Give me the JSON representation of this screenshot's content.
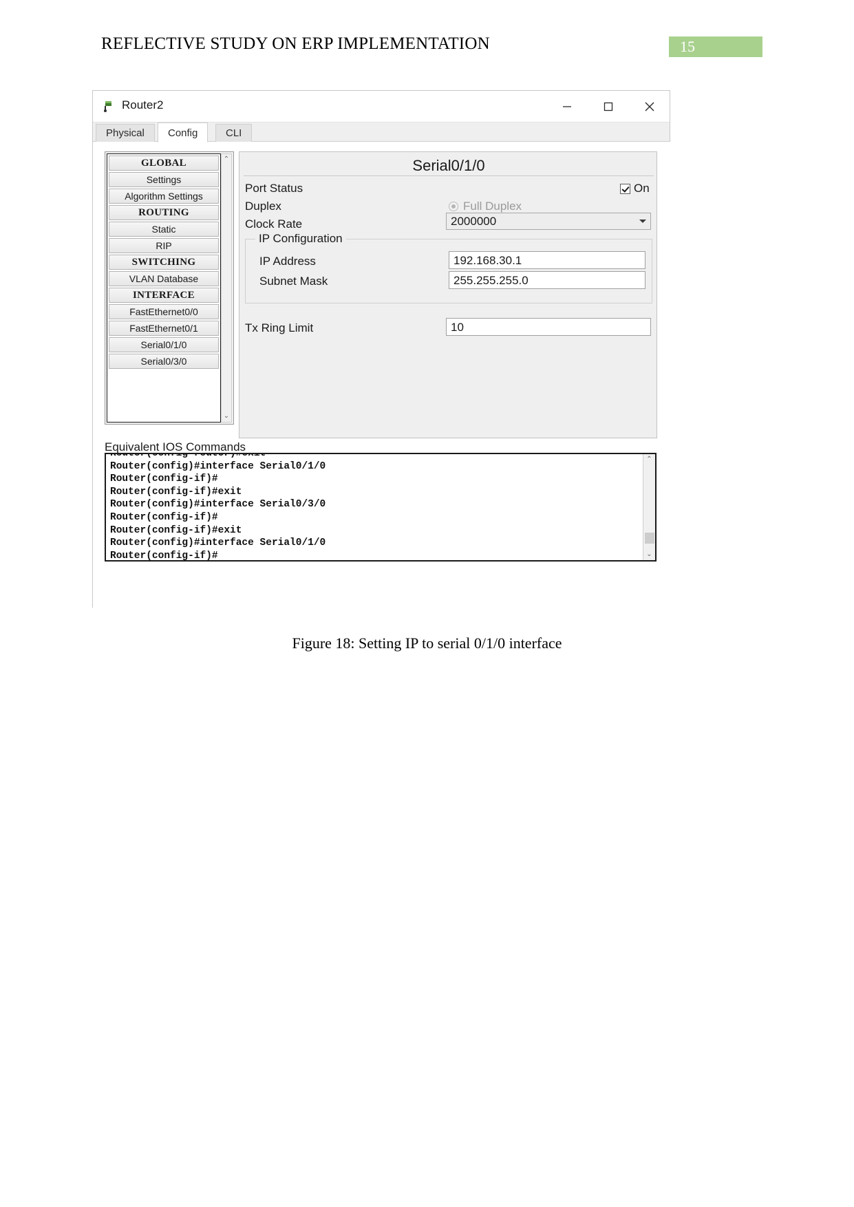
{
  "document": {
    "title": "REFLECTIVE STUDY ON ERP IMPLEMENTATION",
    "page_number": "15",
    "page_badge_color": "#a9d18e",
    "figure_caption": "Figure 18: Setting IP to serial 0/1/0 interface"
  },
  "window": {
    "title": "Router2",
    "icon": "router-icon",
    "controls": {
      "minimize": "—",
      "maximize": "□",
      "close": "✕"
    }
  },
  "tabs": [
    {
      "label": "Physical",
      "active": false
    },
    {
      "label": "Config",
      "active": true
    },
    {
      "label": "CLI",
      "active": false
    }
  ],
  "sidebar": {
    "items": [
      {
        "label": "GLOBAL",
        "type": "header"
      },
      {
        "label": "Settings",
        "type": "item"
      },
      {
        "label": "Algorithm Settings",
        "type": "item"
      },
      {
        "label": "ROUTING",
        "type": "header"
      },
      {
        "label": "Static",
        "type": "item"
      },
      {
        "label": "RIP",
        "type": "item"
      },
      {
        "label": "SWITCHING",
        "type": "header"
      },
      {
        "label": "VLAN Database",
        "type": "item"
      },
      {
        "label": "INTERFACE",
        "type": "header"
      },
      {
        "label": "FastEthernet0/0",
        "type": "item"
      },
      {
        "label": "FastEthernet0/1",
        "type": "item"
      },
      {
        "label": "Serial0/1/0",
        "type": "item"
      },
      {
        "label": "Serial0/3/0",
        "type": "item"
      }
    ],
    "scroll_up": "⌃",
    "scroll_down": "⌄"
  },
  "config_panel": {
    "header": "Serial0/1/0",
    "port_status": {
      "label": "Port Status",
      "checkbox_label": "On",
      "checked": true
    },
    "duplex": {
      "label": "Duplex",
      "option_label": "Full Duplex",
      "selected": true
    },
    "clock_rate": {
      "label": "Clock Rate",
      "value": "2000000"
    },
    "ip_configuration": {
      "title": "IP Configuration",
      "ip_address": {
        "label": "IP Address",
        "value": "192.168.30.1"
      },
      "subnet_mask": {
        "label": "Subnet Mask",
        "value": "255.255.255.0"
      }
    },
    "tx_ring_limit": {
      "label": "Tx Ring Limit",
      "value": "10"
    }
  },
  "ios_commands": {
    "title": "Equivalent IOS Commands",
    "lines": [
      "Router(config-router)#exit",
      "Router(config)#interface Serial0/1/0",
      "Router(config-if)#",
      "Router(config-if)#exit",
      "Router(config)#interface Serial0/3/0",
      "Router(config-if)#",
      "Router(config-if)#exit",
      "Router(config)#interface Serial0/1/0",
      "Router(config-if)#"
    ],
    "scroll_up": "⌃",
    "scroll_down": "⌄"
  }
}
